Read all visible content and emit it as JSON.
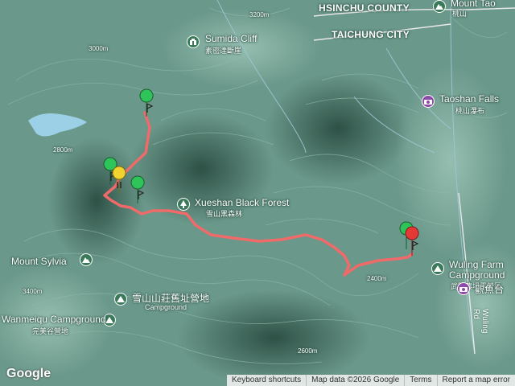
{
  "map": {
    "regions": {
      "hsinchu": "HSINCHU COUNTY",
      "taichung": "TAICHUNG CITY"
    },
    "pois": {
      "sumida_en": "Sumida Cliff",
      "sumida_zh": "素密達斷崖",
      "taoshan_falls_en": "Taoshan Falls",
      "taoshan_falls_zh": "桃山瀑布",
      "mount_tao_en": "Mount Tao",
      "mount_tao_zh": "桃山",
      "black_forest_en": "Xueshan Black Forest",
      "black_forest_zh": "雪山黑森林",
      "mount_sylvia_en": "Mount Sylvia",
      "old_lodge_zh": "雪山山莊舊址營地",
      "old_lodge_en": "Campground",
      "wuling_en_1": "Wuling Farm",
      "wuling_en_2": "Campground",
      "wuling_zh": "武陵農場露營區",
      "fish_zh": "觀魚台",
      "wanmeiqu_en": "Wanmeiqu Campground",
      "wanmeiqu_zh": "完美谷營地",
      "wuling_rd": "Wuling Rd"
    },
    "contours": [
      "3200m",
      "3000m",
      "2800m",
      "2600m",
      "2400m",
      "3400m"
    ],
    "colors": {
      "track": "#f06a6a",
      "marker_green": "#2ec45a",
      "marker_yellow": "#f2d22e",
      "marker_red": "#e53935"
    }
  },
  "footer": {
    "google": "Google",
    "keyboard": "Keyboard shortcuts",
    "map_data": "Map data ©2026 Google",
    "terms": "Terms",
    "report": "Report a map error"
  }
}
